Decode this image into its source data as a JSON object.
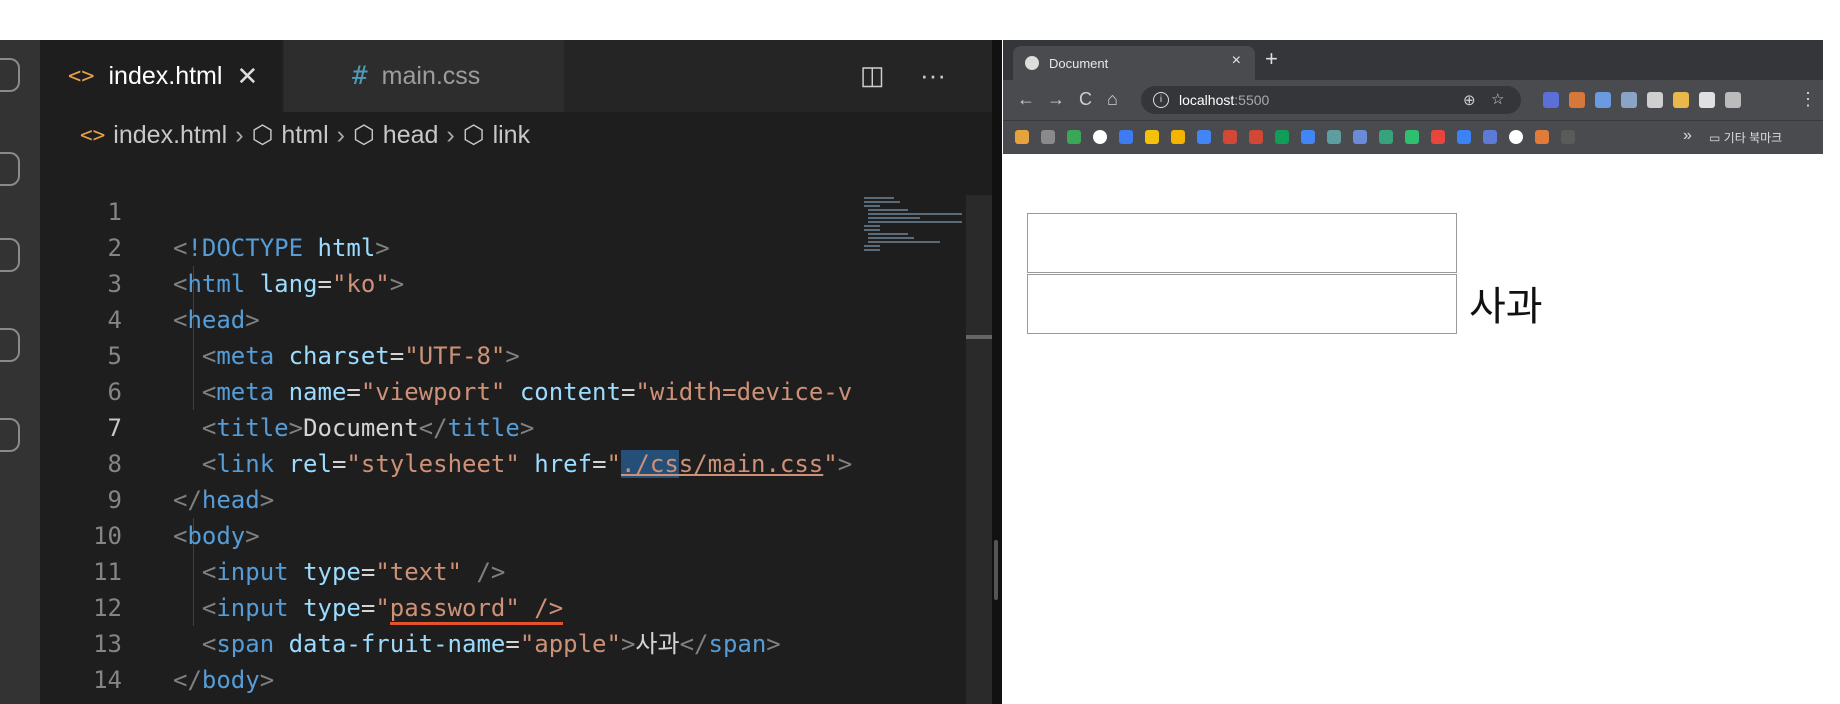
{
  "editor": {
    "tabs": [
      {
        "icon": "<>",
        "label": "index.html",
        "close": "✕",
        "active": true
      },
      {
        "icon": "#",
        "label": "main.css",
        "active": false
      }
    ],
    "split_icon": "◫",
    "more_icon": "···",
    "breadcrumb": [
      {
        "icon": "<>",
        "label": "index.html"
      },
      {
        "icon": "⬡",
        "label": "html"
      },
      {
        "icon": "⬡",
        "label": "head"
      },
      {
        "icon": "⬡",
        "label": "link"
      }
    ],
    "line_numbers": [
      "1",
      "2",
      "3",
      "4",
      "5",
      "6",
      "7",
      "8",
      "9",
      "10",
      "11",
      "12",
      "13",
      "14"
    ],
    "current_line": "7"
  },
  "browser": {
    "tab_title": "Document",
    "tab_close": "×",
    "new_tab": "+",
    "nav": {
      "back": "←",
      "forward": "→",
      "reload": "C",
      "home": "⌂"
    },
    "url_host": "localhost",
    "url_port": ":5500",
    "zoom_icon": "⊕",
    "star_icon": "☆",
    "bookmarks_more": "»",
    "bookmark_folder": "기타 북마크",
    "page": {
      "span_text": "사과"
    }
  }
}
